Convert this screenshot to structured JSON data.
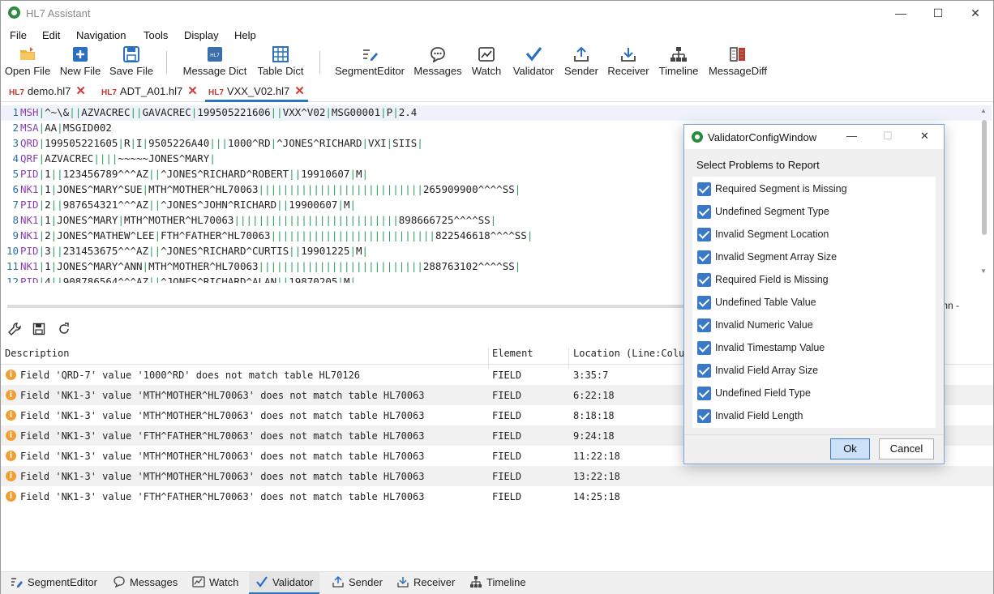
{
  "window": {
    "title": "HL7 Assistant",
    "controls": [
      "—",
      "☐",
      "✕"
    ]
  },
  "menu": [
    "File",
    "Edit",
    "Navigation",
    "Tools",
    "Display",
    "Help"
  ],
  "toolbar": [
    {
      "label": "Open File",
      "icon": "folder-icon"
    },
    {
      "label": "New File",
      "icon": "new-file-icon"
    },
    {
      "label": "Save File",
      "icon": "save-icon"
    },
    {
      "label": "Message Dict",
      "icon": "hl7-dict-icon"
    },
    {
      "label": "Table Dict",
      "icon": "table-icon"
    },
    {
      "label": "SegmentEditor",
      "icon": "edit-icon"
    },
    {
      "label": "Messages",
      "icon": "chat-icon"
    },
    {
      "label": "Watch",
      "icon": "chart-icon"
    },
    {
      "label": "Validator",
      "icon": "check-icon"
    },
    {
      "label": "Sender",
      "icon": "upload-icon"
    },
    {
      "label": "Receiver",
      "icon": "download-icon"
    },
    {
      "label": "Timeline",
      "icon": "timeline-icon"
    },
    {
      "label": "MessageDiff",
      "icon": "diff-icon"
    }
  ],
  "tabs": [
    {
      "badge": "HL7",
      "name": "demo.hl7"
    },
    {
      "badge": "HL7",
      "name": "ADT_A01.hl7"
    },
    {
      "badge": "HL7",
      "name": "VXX_V02.hl7"
    }
  ],
  "editor": {
    "lines": [
      "MSH|^~\\&||AZVACREC||GAVACREC|199505221606||VXX^V02|MSG00001|P|2.4",
      "MSA|AA|MSGID002",
      "QRD|199505221605|R|I|9505226A40|||1000^RD|^JONES^RICHARD|VXI|SIIS|",
      "QRF|AZVACREC||||~~~~~JONES^MARY|",
      "PID|1||123456789^^^AZ||^JONES^RICHARD^ROBERT||19910607|M|",
      "NK1|1|JONES^MARY^SUE|MTH^MOTHER^HL70063|||||||||||||||||||||||||||265909900^^^^SS|",
      "PID|2||987654321^^^AZ||^JONES^JOHN^RICHARD||19900607|M|",
      "NK1|1|JONES^MARY|MTH^MOTHER^HL70063|||||||||||||||||||||||||||898666725^^^^SS|",
      "NK1|2|JONES^MATHEW^LEE|FTH^FATHER^HL70063|||||||||||||||||||||||||||822546618^^^^SS|",
      "PID|3||231453675^^^AZ||^JONES^RICHARD^CURTIS||19901225|M|",
      "NK1|1|JONES^MARY^ANN|MTH^MOTHER^HL70063|||||||||||||||||||||||||||288763102^^^^SS|",
      "PID|4||908786564^^^AZ||^JONES^RICHARD^ALAN||19870205|M|"
    ],
    "status_fragment": "mn -"
  },
  "grid": {
    "headers": [
      "Description",
      "Element",
      "Location (Line:Colu"
    ],
    "rows": [
      {
        "description": "Field 'QRD-7' value '1000^RD' does not match table HL70126",
        "element": "FIELD",
        "location": "3:35:7"
      },
      {
        "description": "Field 'NK1-3' value 'MTH^MOTHER^HL70063' does not match table HL70063",
        "element": "FIELD",
        "location": "6:22:18"
      },
      {
        "description": "Field 'NK1-3' value 'MTH^MOTHER^HL70063' does not match table HL70063",
        "element": "FIELD",
        "location": "8:18:18"
      },
      {
        "description": "Field 'NK1-3' value 'FTH^FATHER^HL70063' does not match table HL70063",
        "element": "FIELD",
        "location": "9:24:18"
      },
      {
        "description": "Field 'NK1-3' value 'MTH^MOTHER^HL70063' does not match table HL70063",
        "element": "FIELD",
        "location": "11:22:18"
      },
      {
        "description": "Field 'NK1-3' value 'MTH^MOTHER^HL70063' does not match table HL70063",
        "element": "FIELD",
        "location": "13:22:18"
      },
      {
        "description": "Field 'NK1-3' value 'FTH^FATHER^HL70063' does not match table HL70063",
        "element": "FIELD",
        "location": "14:25:18"
      }
    ]
  },
  "bottom_tabs": [
    "SegmentEditor",
    "Messages",
    "Watch",
    "Validator",
    "Sender",
    "Receiver",
    "Timeline"
  ],
  "dialog": {
    "title": "ValidatorConfigWindow",
    "heading": "Select Problems to Report",
    "options": [
      "Required Segment is Missing",
      "Undefined Segment Type",
      "Invalid Segment Location",
      "Invalid Segment Array Size",
      "Required Field is Missing",
      "Undefined Table Value",
      "Invalid Numeric Value",
      "Invalid Timestamp Value",
      "Invalid Field Array Size",
      "Undefined Field Type",
      "Invalid Field Length"
    ],
    "ok": "Ok",
    "cancel": "Cancel"
  },
  "colors": {
    "accent": "#3a78c8",
    "warning": "#f0a030",
    "segment": "#8a3fb0",
    "pipe": "#2aa05a",
    "line_number": "#2b6ea7"
  }
}
